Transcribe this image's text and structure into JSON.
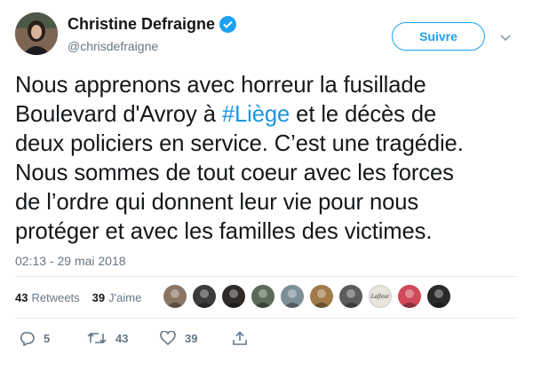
{
  "author": {
    "name": "Christine Defraigne",
    "handle": "@chrisdefraigne",
    "verified": true
  },
  "follow_button": {
    "label": "Suivre"
  },
  "tweet": {
    "lines": [
      {
        "before": "Nous apprenons avec horreur la fusillade"
      },
      {
        "before": "Boulevard d'Avroy à ",
        "hashtag": "#Liège",
        "after": " et le décès de"
      },
      {
        "before": "deux policiers en service. C’est une tragédie."
      },
      {
        "before": "Nous sommes de tout coeur avec les forces"
      },
      {
        "before": "de l’ordre qui donnent leur vie pour nous"
      },
      {
        "before": "protéger et avec les familles des victimes."
      }
    ],
    "timestamp": "02:13 - 29 mai 2018"
  },
  "stats": {
    "retweets_count": "43",
    "retweets_label": "Retweets",
    "likes_count": "39",
    "likes_label": "J'aime"
  },
  "likers": {
    "count": 10,
    "colors": [
      "#8a7563",
      "#3b3b3b",
      "#2f2a26",
      "#5a6b57",
      "#7d8f98",
      "#a07a4a",
      "#5c5c5c",
      "#e8e4dc",
      "#d04a5a",
      "#2a2a2a"
    ],
    "text_avatar": "Lafleur"
  },
  "actions": {
    "reply_count": "5",
    "retweet_count": "43",
    "like_count": "39"
  },
  "colors": {
    "accent": "#1da1f2",
    "hashtag": "#1b95e0",
    "muted": "#657786"
  },
  "icons": [
    "verified-badge-icon",
    "chevron-down-icon",
    "reply-icon",
    "retweet-icon",
    "like-icon",
    "share-icon"
  ]
}
